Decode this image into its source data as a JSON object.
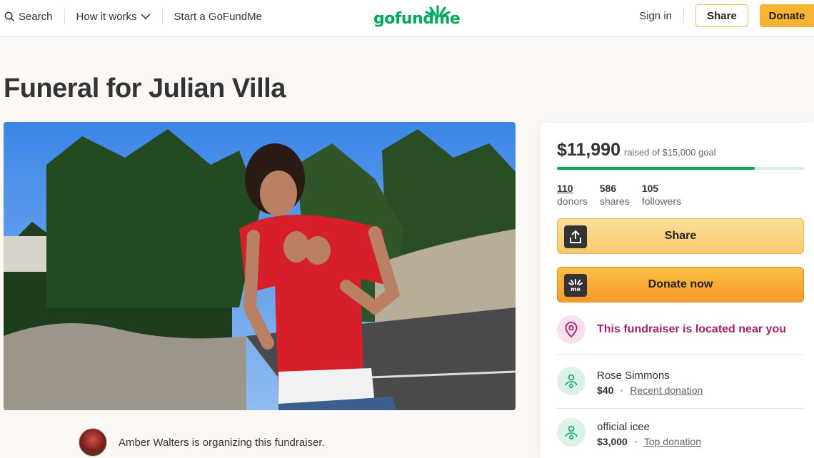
{
  "header": {
    "search_label": "Search",
    "how_it_works_label": "How it works",
    "start_label": "Start a GoFundMe",
    "logo_text": "gofundme",
    "signin_label": "Sign in",
    "share_label": "Share",
    "donate_label": "Donate"
  },
  "page": {
    "title": "Funeral for Julian Villa"
  },
  "organizer": {
    "text": "Amber Walters is organizing this fundraiser."
  },
  "campaign": {
    "raised": "$11,990",
    "goal_text": "raised of $15,000 goal",
    "progress_fraction": 0.7993,
    "donors_count": "110",
    "donors_label": "donors",
    "shares_count": "586",
    "shares_label": "shares",
    "followers_count": "105",
    "followers_label": "followers",
    "share_button": "Share",
    "donate_button": "Donate now",
    "near_text": "This fundraiser is located near you"
  },
  "donations": [
    {
      "name": "Rose Simmons",
      "amount": "$40",
      "tag": "Recent donation"
    },
    {
      "name": "official icee",
      "amount": "$3,000",
      "tag": "Top donation"
    }
  ],
  "colors": {
    "brand_green": "#02a95c",
    "donate_orange": "#f6b334",
    "near_purple": "#a21f6b"
  }
}
